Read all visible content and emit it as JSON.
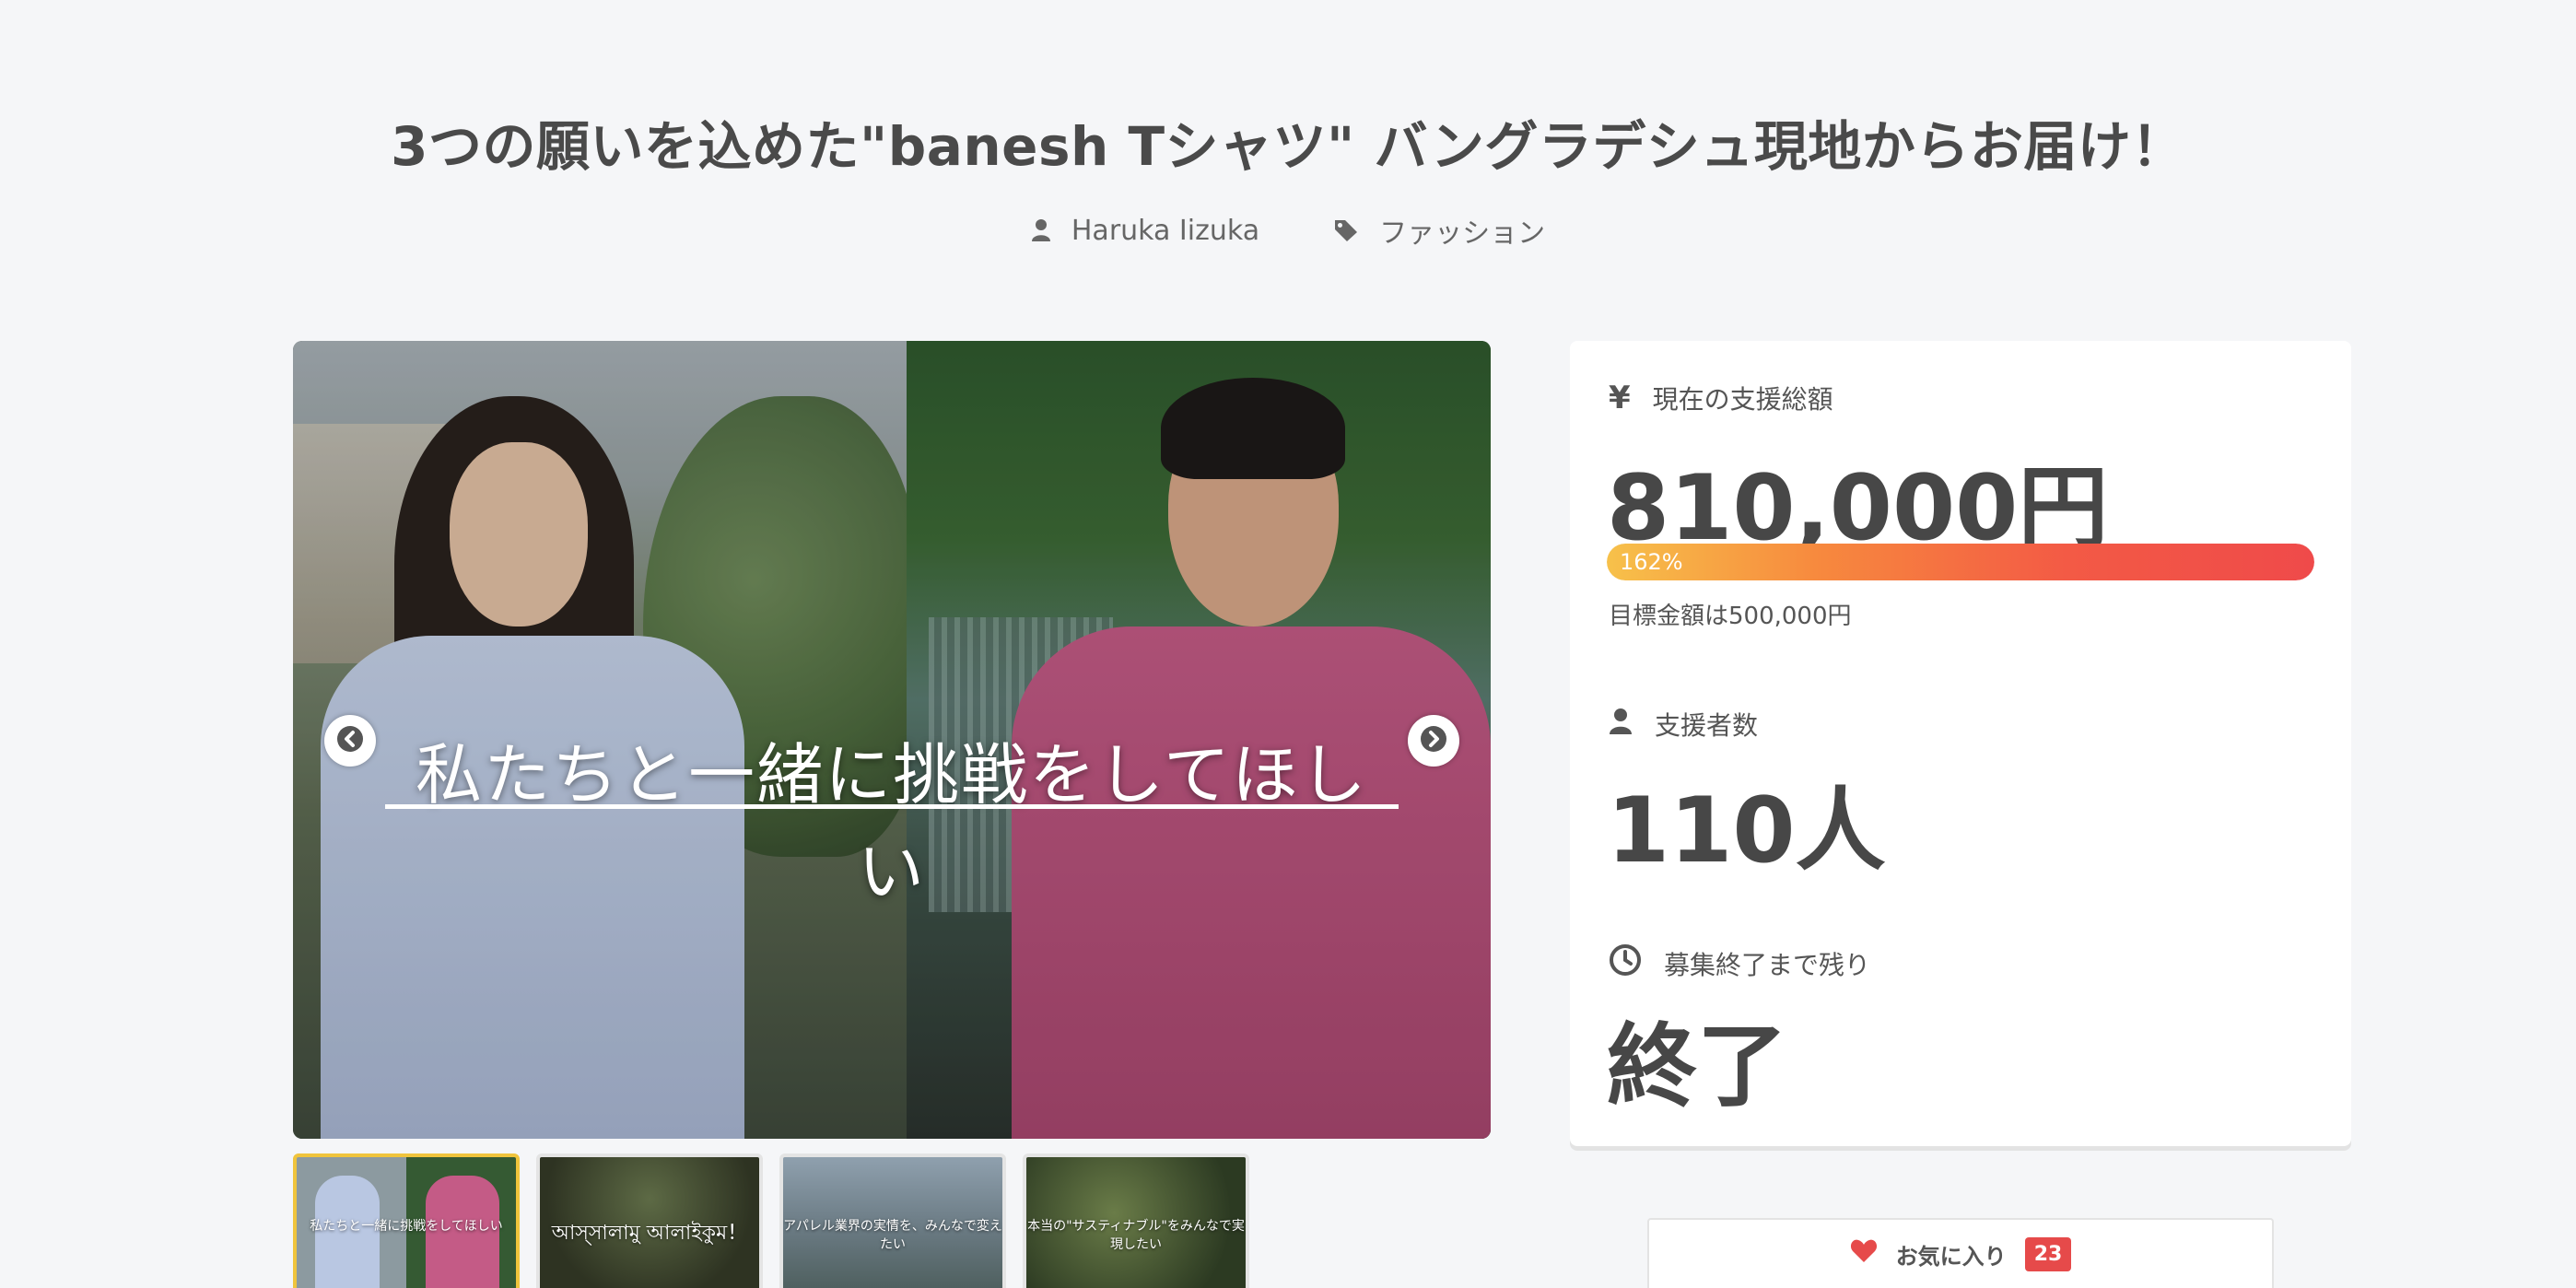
{
  "project": {
    "title": "3つの願いを込めた\"banesh Tシャツ\" バングラデシュ現地からお届け！",
    "author": "Haruka Iizuka",
    "category": "ファッション"
  },
  "carousel": {
    "caption": "私たちと一緒に挑戦をしてほしい",
    "thumbnails": [
      {
        "text": "私たちと一緒に挑戦をしてほしい",
        "active": true
      },
      {
        "text": "আস্সালামু আলাইকুম！",
        "active": false
      },
      {
        "text": "アパレル業界の実情を、みんなで変えたい",
        "active": false
      },
      {
        "text": "本当の\"サスティナブル\"をみんなで実現したい",
        "active": false
      }
    ]
  },
  "stats": {
    "total_label": "現在の支援総額",
    "total_value": "810,000円",
    "progress_percent": 162,
    "progress_label": "162%",
    "goal_text": "目標金額は500,000円",
    "backers_label": "支援者数",
    "backers_value": "110人",
    "remaining_label": "募集終了まで残り",
    "remaining_value": "終了"
  },
  "favorite": {
    "label": "お気に入り",
    "count": "23"
  },
  "colors": {
    "accent_red": "#e64a4a",
    "progress_start": "#f7c14a",
    "progress_end": "#ef4a4a",
    "thumb_active_border": "#f0c43c"
  },
  "icons": {
    "author": "user-icon",
    "category": "tag-icon",
    "total": "yen-icon",
    "backers": "user-icon",
    "remaining": "clock-icon",
    "favorite": "heart-icon",
    "prev": "chevron-left-icon",
    "next": "chevron-right-icon"
  }
}
